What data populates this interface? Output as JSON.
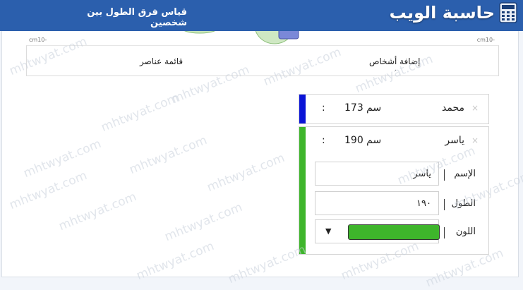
{
  "header": {
    "site_name": "حاسبة الويب",
    "page_title": "قياس فرق الطول بين شخصين",
    "background": "#2b5fad"
  },
  "chart": {
    "axis_left_label": "cm10-",
    "axis_right_label": "cm10-"
  },
  "tabs": {
    "add_people": "إضافة أشخاص",
    "add_people_dot": "٠",
    "items_list": "قائمة عناصر"
  },
  "people": [
    {
      "name": "محمد",
      "height": "173 سم",
      "colon": ":",
      "close": "×",
      "color": "#0a14d6"
    },
    {
      "name": "ياسر",
      "height": "190 سم",
      "colon": ":",
      "close": "×",
      "color": "#3eb52b",
      "form": {
        "name_label": "الإسم",
        "name_value": "ياسر",
        "height_label": "الطول",
        "height_value": "١٩٠",
        "color_label": "اللون",
        "caret": "▼"
      }
    }
  ],
  "watermark": {
    "text": "mhtwyat.com"
  }
}
